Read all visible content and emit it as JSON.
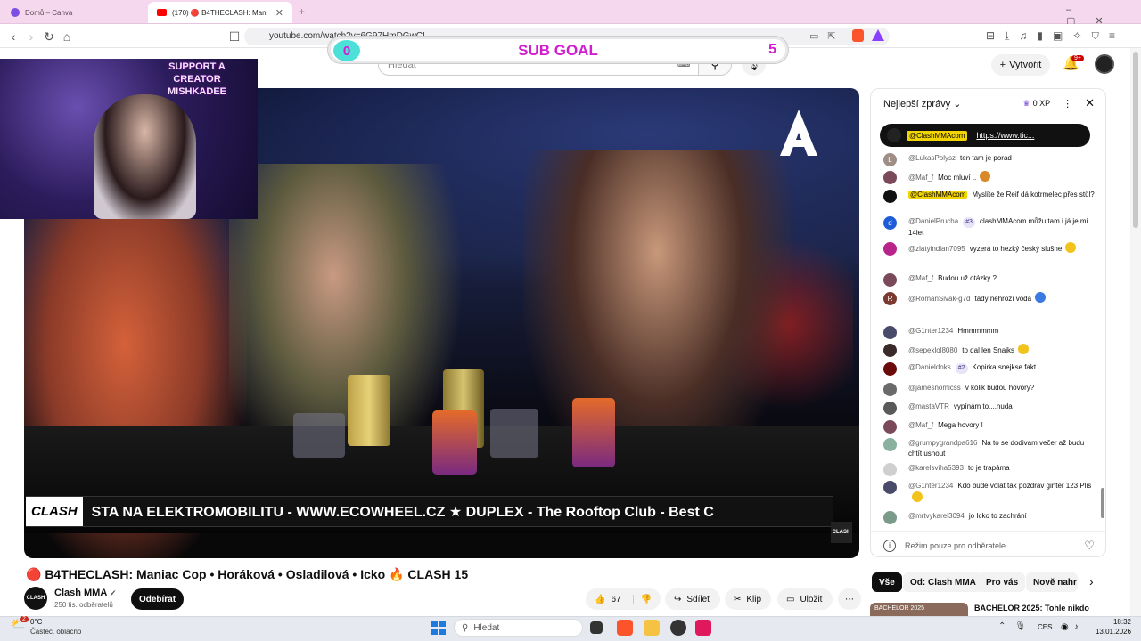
{
  "browser": {
    "tabs": [
      {
        "label": "Domů – Canva",
        "active": false
      },
      {
        "label": "(170) 🔴 B4THECLASH: Mani",
        "active": true
      }
    ],
    "url": "youtube.com/watch?v=6G97HmDGwCI"
  },
  "overlay": {
    "sub_goal_label": "SUB GOAL",
    "sub_goal_current": "0",
    "sub_goal_target": "5",
    "webcam_text": "SUPPORT A CREATOR MISHKADEE"
  },
  "header": {
    "search_placeholder": "Hledat",
    "create_label": "Vytvořit",
    "notifications_badge": "9+"
  },
  "video": {
    "ticker_logo": "CLASH",
    "ticker_text": "STA NA ELEKTROMOBILITU - WWW.ECOWHEEL.CZ   ★   DUPLEX - The Rooftop Club - Best C",
    "watermark": "CLASH"
  },
  "below_video": {
    "title": "🔴 B4THECLASH: Maniac Cop • Horáková • Osladilová • Icko 🔥 CLASH 15",
    "channel_name": "Clash MMA",
    "channel_subs": "250 tis. odběratelů",
    "subscribe_label": "Odebírat",
    "likes": "67",
    "share_label": "Sdílet",
    "clip_label": "Klip",
    "save_label": "Uložit"
  },
  "chat": {
    "header_label": "Nejlepší zprávy",
    "xp_label": "0 XP",
    "pinned_author": "@ClashMMAcom",
    "pinned_text": "https://www.tic...",
    "messages": [
      {
        "author": "@LukasPolysz",
        "text": "ten tam je porad",
        "color": "#9e8e86",
        "avatar_letter": "L"
      },
      {
        "author": "@Maf_f",
        "text": "Moc mluví ..",
        "color": "#7a4a5a",
        "emoji": "#d9892a"
      },
      {
        "author": "@ClashMMAcom",
        "text": "Myslíte že Reif dá kotrmelec přes stůl?",
        "color": "#111",
        "mod": true
      },
      {
        "author": "@DanielPrucha",
        "badge": "#3",
        "text": "clashMMAcom můžu tam i já je mi 14let",
        "color": "#1e5bd6",
        "avatar_letter": "d"
      },
      {
        "author": "@zlatyindian7095",
        "text": "vyzerá to hezký český slušne",
        "color": "#b8258a",
        "emoji": "#f2c31c"
      },
      {
        "author": "@Maf_f",
        "text": "Budou už otázky ?",
        "color": "#7a4a5a"
      },
      {
        "author": "@RomanSivak-g7d",
        "text": "tady nehrozí voda",
        "color": "#7a3a30",
        "avatar_letter": "R",
        "emoji": "#3b7ae0"
      },
      {
        "author": "@G1nter1234",
        "text": "Hmmmmmm",
        "color": "#4a4a6a"
      },
      {
        "author": "@sepexlol8080",
        "text": "to dal len Snajks",
        "color": "#3a2a2a",
        "emoji": "#f2c31c"
      },
      {
        "author": "@Danieldoks",
        "badge": "#2",
        "text": "Kopirka snejkse fakt",
        "color": "#6a0a0a"
      },
      {
        "author": "@jamesnomicss",
        "text": "v kolik budou hovory?",
        "color": "#6a6a6a"
      },
      {
        "author": "@mastaVTR",
        "text": "vypínám to....nuda",
        "color": "#5a5a5a"
      },
      {
        "author": "@Maf_f",
        "text": "Mega hovory !",
        "color": "#7a4a5a"
      },
      {
        "author": "@grumpygrandpa616",
        "text": "Na to se dodivam večer až budu chtít usnout",
        "color": "#8ab0a0"
      },
      {
        "author": "@karelsviha5393",
        "text": "to je trapáma",
        "color": "#cfcfcf"
      },
      {
        "author": "@G1nter1234",
        "text": "Kdo bude volat tak pozdrav ginter 123 Plis",
        "color": "#4a4a6a",
        "emoji": "#f2c31c"
      },
      {
        "author": "@mrtvykarel3094",
        "text": "jo Icko to zachrání",
        "color": "#7a9a8a"
      }
    ],
    "footer_text": "Režim pouze pro odběratele"
  },
  "chips": [
    "Vše",
    "Od: Clash MMA",
    "Pro vás",
    "Nově nahr"
  ],
  "recommendation": {
    "thumb_text": "BACHELOR 2025",
    "title": "BACHELOR 2025: Tohle nikdo"
  },
  "taskbar": {
    "weather_temp": "0°C",
    "weather_desc": "Částeč. oblačno",
    "weather_badge": "2",
    "search_label": "Hledat",
    "lang": "CES",
    "time": "18:32",
    "date": "13.01.2026"
  }
}
